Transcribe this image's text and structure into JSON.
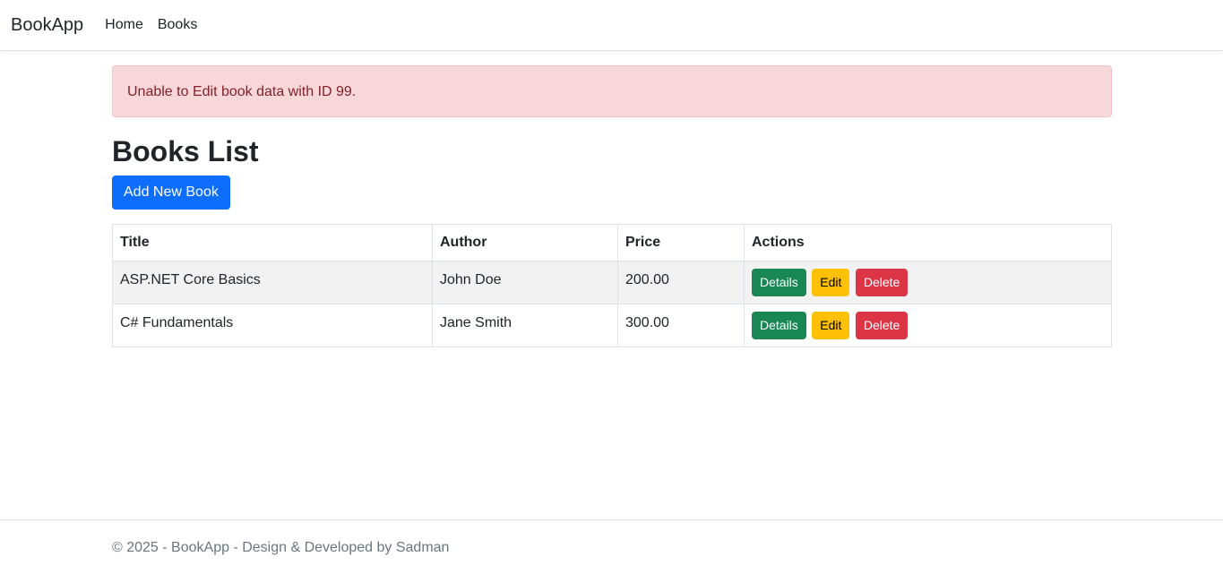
{
  "navbar": {
    "brand": "BookApp",
    "links": [
      {
        "label": "Home"
      },
      {
        "label": "Books"
      }
    ]
  },
  "alert": {
    "message": "Unable to Edit book data with ID 99.",
    "type": "danger"
  },
  "page": {
    "title": "Books List",
    "add_button": "Add New Book"
  },
  "table": {
    "headers": [
      "Title",
      "Author",
      "Price",
      "Actions"
    ],
    "rows": [
      {
        "title": "ASP.NET Core Basics",
        "author": "John Doe",
        "price": "200.00"
      },
      {
        "title": "C# Fundamentals",
        "author": "Jane Smith",
        "price": "300.00"
      }
    ],
    "actions": {
      "details": "Details",
      "edit": "Edit",
      "delete": "Delete"
    }
  },
  "footer": {
    "text": "© 2025 - BookApp - Design & Developed by Sadman"
  },
  "colors": {
    "primary": "#0d6efd",
    "success": "#198754",
    "warning": "#ffc107",
    "danger": "#dc3545",
    "alert_bg": "#f8d7da",
    "alert_text": "#842029"
  }
}
